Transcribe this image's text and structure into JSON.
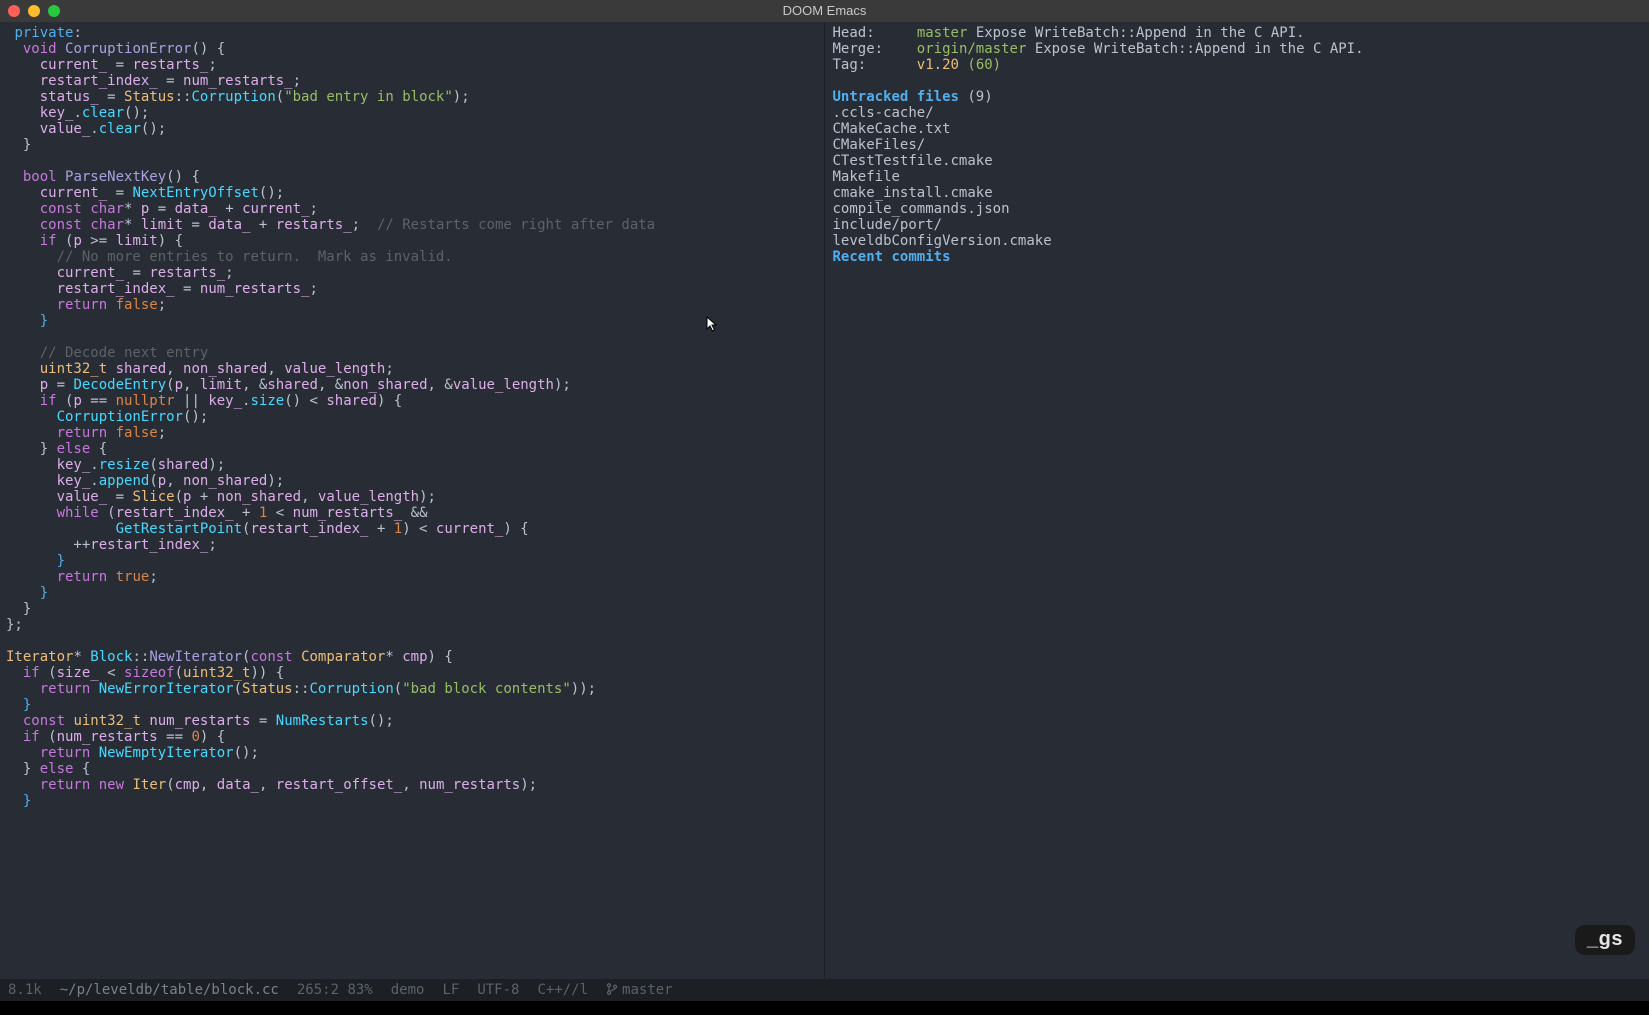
{
  "title": "DOOM Emacs",
  "modeline": {
    "size": "8.1k",
    "path": "~/p/leveldb/table/block.cc",
    "pos": "265:2 83%",
    "mode1": "demo",
    "eol": "LF",
    "enc": "UTF-8",
    "major": "C++//l",
    "vc": "master"
  },
  "badge": "_gs",
  "magit": {
    "head_label": "Head:",
    "head_branch": "master",
    "head_msg": "Expose WriteBatch::Append in the C API.",
    "merge_label": "Merge:",
    "merge_branch": "origin/master",
    "merge_msg": "Expose WriteBatch::Append in the C API.",
    "tag_label": "Tag:",
    "tag_name": "v1.20",
    "tag_dist": "(60)",
    "untracked_header": "Untracked files",
    "untracked_count": "(9)",
    "untracked": [
      ".ccls-cache/",
      "CMakeCache.txt",
      "CMakeFiles/",
      "CTestTestfile.cmake",
      "Makefile",
      "cmake_install.cmake",
      "compile_commands.json",
      "include/port/",
      "leveldbConfigVersion.cmake"
    ],
    "recent_header": "Recent commits"
  },
  "code": {
    "l01a": "private",
    "l02a": "void",
    "l02b": "CorruptionError",
    "l03a": "current_",
    "l03b": "restarts_",
    "l04a": "restart_index_",
    "l04b": "num_restarts_",
    "l05a": "status_",
    "l05b": "Status",
    "l05c": "Corruption",
    "l05d": "\"bad entry in block\"",
    "l06a": "key_",
    "l06b": "clear",
    "l07a": "value_",
    "l07b": "clear",
    "l09a": "bool",
    "l09b": "ParseNextKey",
    "l10a": "current_",
    "l10b": "NextEntryOffset",
    "l11a": "const",
    "l11b": "char",
    "l11c": "p",
    "l11d": "data_",
    "l11e": "current_",
    "l12a": "const",
    "l12b": "char",
    "l12c": "limit",
    "l12d": "data_",
    "l12e": "restarts_",
    "l12f": "// Restarts come right after data",
    "l13a": "if",
    "l13b": "p",
    "l13c": "limit",
    "l14a": "// No more entries to return.  Mark as invalid.",
    "l15a": "current_",
    "l15b": "restarts_",
    "l16a": "restart_index_",
    "l16b": "num_restarts_",
    "l17a": "return",
    "l17b": "false",
    "l19a": "// Decode next entry",
    "l20a": "uint32_t",
    "l20b": "shared",
    "l20c": "non_shared",
    "l20d": "value_length",
    "l21a": "p",
    "l21b": "DecodeEntry",
    "l21c": "p",
    "l21d": "limit",
    "l21e": "shared",
    "l21f": "non_shared",
    "l21g": "value_length",
    "l22a": "if",
    "l22b": "p",
    "l22c": "nullptr",
    "l22d": "key_",
    "l22e": "size",
    "l22f": "shared",
    "l23a": "CorruptionError",
    "l24a": "return",
    "l24b": "false",
    "l25a": "else",
    "l26a": "key_",
    "l26b": "resize",
    "l26c": "shared",
    "l27a": "key_",
    "l27b": "append",
    "l27c": "p",
    "l27d": "non_shared",
    "l28a": "value_",
    "l28b": "Slice",
    "l28c": "p",
    "l28d": "non_shared",
    "l28e": "value_length",
    "l29a": "while",
    "l29b": "restart_index_",
    "l29c": "1",
    "l29d": "num_restarts_",
    "l30a": "GetRestartPoint",
    "l30b": "restart_index_",
    "l30c": "1",
    "l30d": "current_",
    "l31a": "restart_index_",
    "l32a": "return",
    "l32b": "true",
    "l36a": "Iterator",
    "l36b": "Block",
    "l36c": "NewIterator",
    "l36d": "const",
    "l36e": "Comparator",
    "l36f": "cmp",
    "l37a": "if",
    "l37b": "size_",
    "l37c": "sizeof",
    "l37d": "uint32_t",
    "l38a": "return",
    "l38b": "NewErrorIterator",
    "l38c": "Status",
    "l38d": "Corruption",
    "l38e": "\"bad block contents\"",
    "l40a": "const",
    "l40b": "uint32_t",
    "l40c": "num_restarts",
    "l40d": "NumRestarts",
    "l41a": "if",
    "l41b": "num_restarts",
    "l41c": "0",
    "l42a": "return",
    "l42b": "NewEmptyIterator",
    "l43a": "else",
    "l44a": "return",
    "l44b": "new",
    "l44c": "Iter",
    "l44d": "cmp",
    "l44e": "data_",
    "l44f": "restart_offset_",
    "l44g": "num_restarts"
  }
}
